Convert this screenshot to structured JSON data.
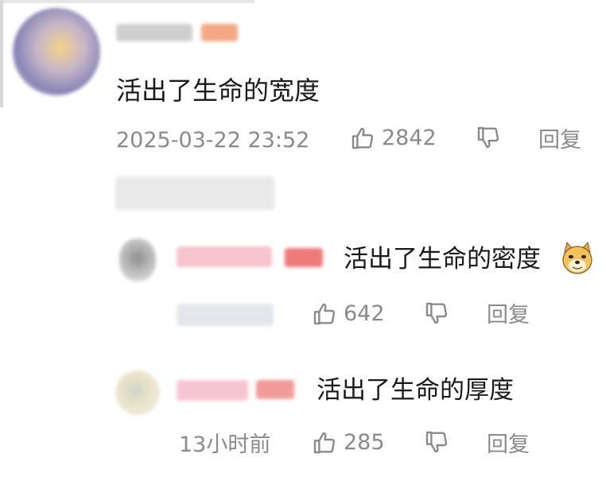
{
  "comment": {
    "text": "活出了生命的宽度",
    "timestamp": "2025-03-22 23:52",
    "like_count": "2842",
    "reply_label": "回复"
  },
  "replies": [
    {
      "text": "活出了生命的密度",
      "emoji": "doge-emoji",
      "like_count": "642",
      "reply_label": "回复"
    },
    {
      "text": "活出了生命的厚度",
      "time": "13小时前",
      "like_count": "285",
      "reply_label": "回复"
    }
  ],
  "colors": {
    "text": "#1a1a1a",
    "meta": "#8a8a8a",
    "tag_orange": "#f3a783",
    "tag_red": "#ee7a7a",
    "name_pink": "#f6c3cf"
  }
}
